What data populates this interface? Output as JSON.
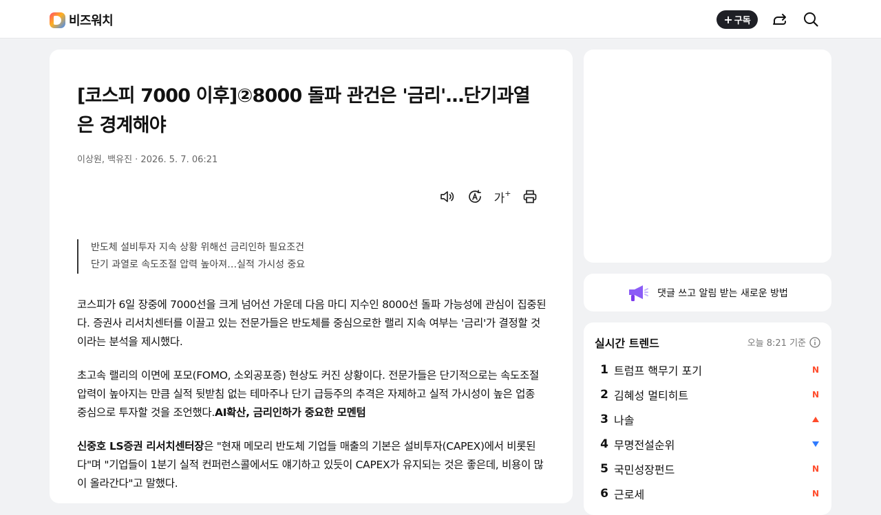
{
  "header": {
    "logo_text": "비즈워치",
    "subscribe_label": "구독",
    "icons": [
      "share-icon",
      "search-icon"
    ]
  },
  "article": {
    "title": "[코스피 7000 이후]②8000 돌파 관건은 '금리'…단기과열은 경계해야",
    "byline": "이상원, 백유진 · 2026. 5. 7. 06:21",
    "tools": [
      "speaker-icon",
      "translate-icon",
      "font-size-icon",
      "print-icon"
    ],
    "font_size_glyph": "가",
    "summary": [
      "반도체 설비투자 지속 상황 위해선 금리인하 필요조건",
      "단기 과열로 속도조절 압력 높아져…실적 가시성 중요"
    ],
    "paragraphs": [
      {
        "text": "코스피가 6일 장중에 7000선을 크게 넘어선 가운데 다음 마디 지수인 8000선 돌파 가능성에 관심이 집중된다. 증권사 리서치센터를 이끌고 있는 전문가들은 반도체를 중심으로한 랠리 지속 여부는 '금리'가 결정할 것이라는 분석을 제시했다.",
        "bold_suffix": "",
        "bold_prefix": ""
      },
      {
        "text": "초고속 랠리의 이면에 포모(FOMO, 소외공포증) 현상도 커진 상황이다. 전문가들은 단기적으로는 속도조절 압력이 높아지는 만큼 실적 뒷받침 없는 테마주나 단기 급등주의 추격은 자제하고 실적 가시성이 높은 업종 중심으로 투자할 것을 조언했다.",
        "bold_suffix": "AI확산, 금리인하가 중요한 모멘텀",
        "bold_prefix": ""
      },
      {
        "text": "은 \"현재 메모리 반도체 기업들 매출의 기본은 설비투자(CAPEX)에서 비롯된다\"며 \"기업들이 1분기 실적 컨퍼런스콜에서도 얘기하고 있듯이 CAPEX가 유지되는 것은 좋은데, 비용이 많이 올라간다\"고 말했다.",
        "bold_suffix": "",
        "bold_prefix": "신중호 LS증권 리서치센터장"
      }
    ]
  },
  "notice": {
    "text": "댓글 쓰고 알림 받는 새로운 방법",
    "icon": "megaphone-icon"
  },
  "trend": {
    "title": "실시간 트렌드",
    "time": "오늘 8:21 기준",
    "items": [
      {
        "rank": "1",
        "keyword": "트럼프 핵무기 포기",
        "status": "new"
      },
      {
        "rank": "2",
        "keyword": "김혜성 멀티히트",
        "status": "new"
      },
      {
        "rank": "3",
        "keyword": "나솔",
        "status": "up"
      },
      {
        "rank": "4",
        "keyword": "무명전설순위",
        "status": "down"
      },
      {
        "rank": "5",
        "keyword": "국민성장펀드",
        "status": "new"
      },
      {
        "rank": "6",
        "keyword": "근로세",
        "status": "new"
      }
    ],
    "badge_new": "N",
    "colors": {
      "new": "#ff4b2b",
      "up": "#ff4b2b",
      "down": "#2f7bff"
    }
  }
}
